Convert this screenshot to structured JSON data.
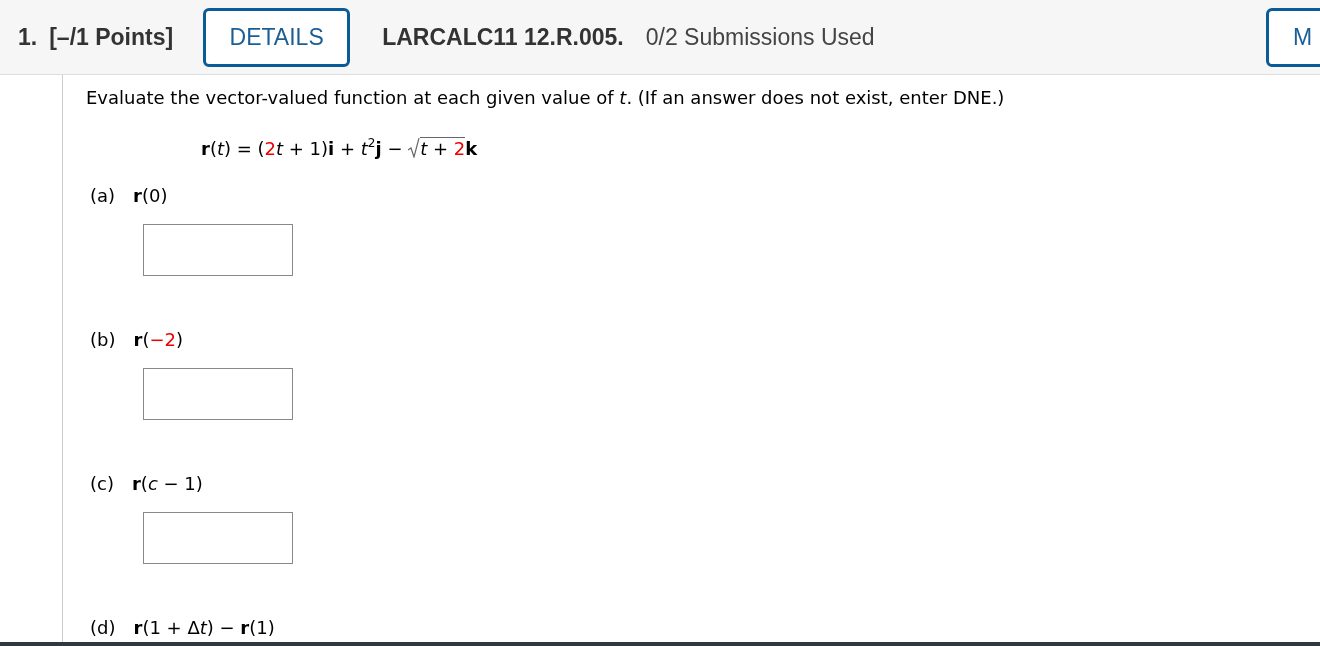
{
  "header": {
    "number": "1.",
    "points": "[–/1 Points]",
    "details_button": "DETAILS",
    "problem_id": "LARCALC11 12.R.005.",
    "submissions": "0/2 Submissions Used",
    "edge_button": "M"
  },
  "instructions": "Evaluate the vector-valued function at each given value of *t*. (If an answer does not exist, enter DNE.)",
  "formula": [
    {
      "kind": "bold",
      "text": "r"
    },
    {
      "kind": "plain",
      "text": "("
    },
    {
      "kind": "italic",
      "text": "t"
    },
    {
      "kind": "plain",
      "text": ") = ("
    },
    {
      "kind": "highlight",
      "text": "2"
    },
    {
      "kind": "italic",
      "text": "t"
    },
    {
      "kind": "plain",
      "text": " + 1)"
    },
    {
      "kind": "bold",
      "text": "i"
    },
    {
      "kind": "plain",
      "text": " + "
    },
    {
      "kind": "italic",
      "text": "t"
    },
    {
      "kind": "sup",
      "text": "2"
    },
    {
      "kind": "bold",
      "text": "j"
    },
    {
      "kind": "plain",
      "text": " − "
    },
    {
      "kind": "sqrt",
      "children": [
        {
          "kind": "italic",
          "text": "t"
        },
        {
          "kind": "plain",
          "text": " + "
        },
        {
          "kind": "highlight",
          "text": "2"
        }
      ]
    },
    {
      "kind": "bold",
      "text": "k"
    }
  ],
  "parts": [
    {
      "label": "(a)",
      "kind": "with-field",
      "expression": [
        {
          "kind": "bold",
          "text": "r"
        },
        {
          "kind": "plain",
          "text": "(0)"
        }
      ]
    },
    {
      "label": "(b)",
      "kind": "with-field",
      "expression": [
        {
          "kind": "bold",
          "text": "r"
        },
        {
          "kind": "plain",
          "text": "("
        },
        {
          "kind": "highlight",
          "text": "−2"
        },
        {
          "kind": "plain",
          "text": ")"
        }
      ]
    },
    {
      "label": "(c)",
      "kind": "with-field",
      "expression": [
        {
          "kind": "bold",
          "text": "r"
        },
        {
          "kind": "plain",
          "text": "("
        },
        {
          "kind": "italic",
          "text": "c"
        },
        {
          "kind": "plain",
          "text": " − 1)"
        }
      ]
    },
    {
      "label": "(d)",
      "kind": "label-only",
      "expression": [
        {
          "kind": "bold",
          "text": "r"
        },
        {
          "kind": "plain",
          "text": "(1 + Δ"
        },
        {
          "kind": "italic",
          "text": "t"
        },
        {
          "kind": "plain",
          "text": ") − "
        },
        {
          "kind": "bold",
          "text": "r"
        },
        {
          "kind": "plain",
          "text": "(1)"
        }
      ]
    }
  ]
}
